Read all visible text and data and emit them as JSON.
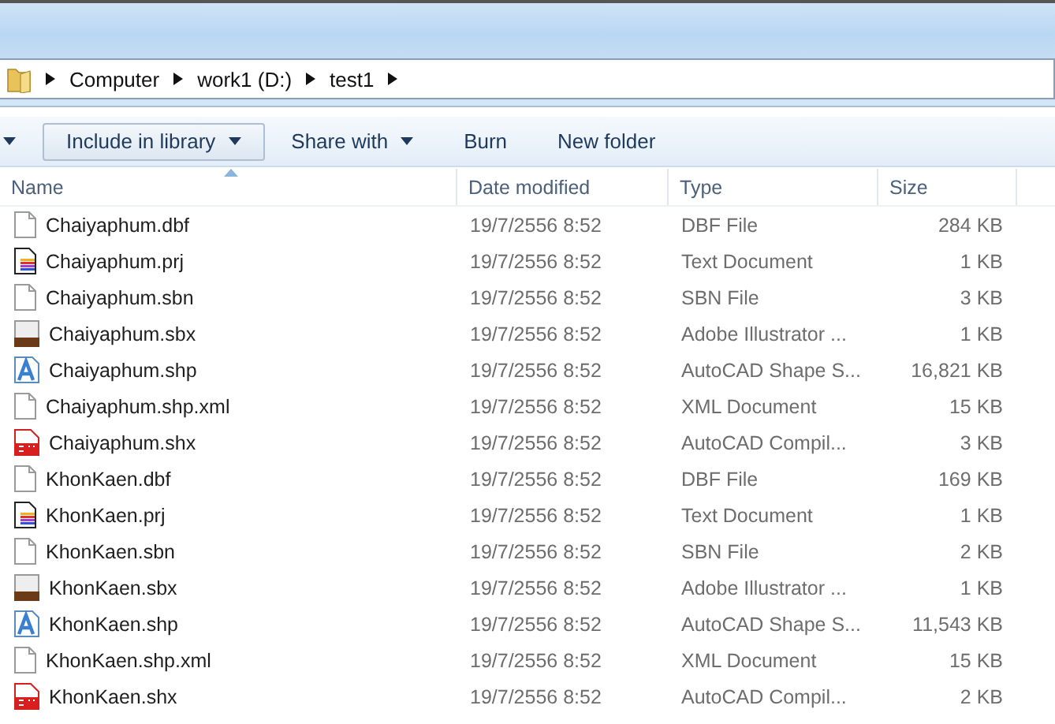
{
  "address_bar": {
    "crumbs": [
      "Computer",
      "work1 (D:)",
      "test1"
    ]
  },
  "toolbar": {
    "buttons": [
      {
        "label": "Include in library",
        "dropdown": true,
        "pressed": true
      },
      {
        "label": "Share with",
        "dropdown": true,
        "pressed": false
      },
      {
        "label": "Burn",
        "dropdown": false,
        "pressed": false
      },
      {
        "label": "New folder",
        "dropdown": false,
        "pressed": false
      }
    ]
  },
  "table": {
    "columns": [
      {
        "label": "Name",
        "sorted": true
      },
      {
        "label": "Date modified",
        "sorted": false
      },
      {
        "label": "Type",
        "sorted": false
      },
      {
        "label": "Size",
        "sorted": false
      }
    ],
    "rows": [
      {
        "kind": "blank",
        "name": "Chaiyaphum.dbf",
        "date": "19/7/2556 8:52",
        "type": "DBF File",
        "size": "284 KB"
      },
      {
        "kind": "text",
        "name": "Chaiyaphum.prj",
        "date": "19/7/2556 8:52",
        "type": "Text Document",
        "size": "1 KB"
      },
      {
        "kind": "blank",
        "name": "Chaiyaphum.sbn",
        "date": "19/7/2556 8:52",
        "type": "SBN File",
        "size": "3 KB"
      },
      {
        "kind": "sbx",
        "name": "Chaiyaphum.sbx",
        "date": "19/7/2556 8:52",
        "type": "Adobe Illustrator ...",
        "size": "1 KB"
      },
      {
        "kind": "shape",
        "name": "Chaiyaphum.shp",
        "date": "19/7/2556 8:52",
        "type": "AutoCAD Shape S...",
        "size": "16,821 KB"
      },
      {
        "kind": "blank",
        "name": "Chaiyaphum.shp.xml",
        "date": "19/7/2556 8:52",
        "type": "XML Document",
        "size": "15 KB"
      },
      {
        "kind": "shx",
        "name": "Chaiyaphum.shx",
        "date": "19/7/2556 8:52",
        "type": "AutoCAD Compil...",
        "size": "3 KB"
      },
      {
        "kind": "blank",
        "name": "KhonKaen.dbf",
        "date": "19/7/2556 8:52",
        "type": "DBF File",
        "size": "169 KB"
      },
      {
        "kind": "text",
        "name": "KhonKaen.prj",
        "date": "19/7/2556 8:52",
        "type": "Text Document",
        "size": "1 KB"
      },
      {
        "kind": "blank",
        "name": "KhonKaen.sbn",
        "date": "19/7/2556 8:52",
        "type": "SBN File",
        "size": "2 KB"
      },
      {
        "kind": "sbx",
        "name": "KhonKaen.sbx",
        "date": "19/7/2556 8:52",
        "type": "Adobe Illustrator ...",
        "size": "1 KB"
      },
      {
        "kind": "shape",
        "name": "KhonKaen.shp",
        "date": "19/7/2556 8:52",
        "type": "AutoCAD Shape S...",
        "size": "11,543 KB"
      },
      {
        "kind": "blank",
        "name": "KhonKaen.shp.xml",
        "date": "19/7/2556 8:52",
        "type": "XML Document",
        "size": "15 KB"
      },
      {
        "kind": "shx",
        "name": "KhonKaen.shx",
        "date": "19/7/2556 8:52",
        "type": "AutoCAD Compil...",
        "size": "2 KB"
      }
    ]
  }
}
